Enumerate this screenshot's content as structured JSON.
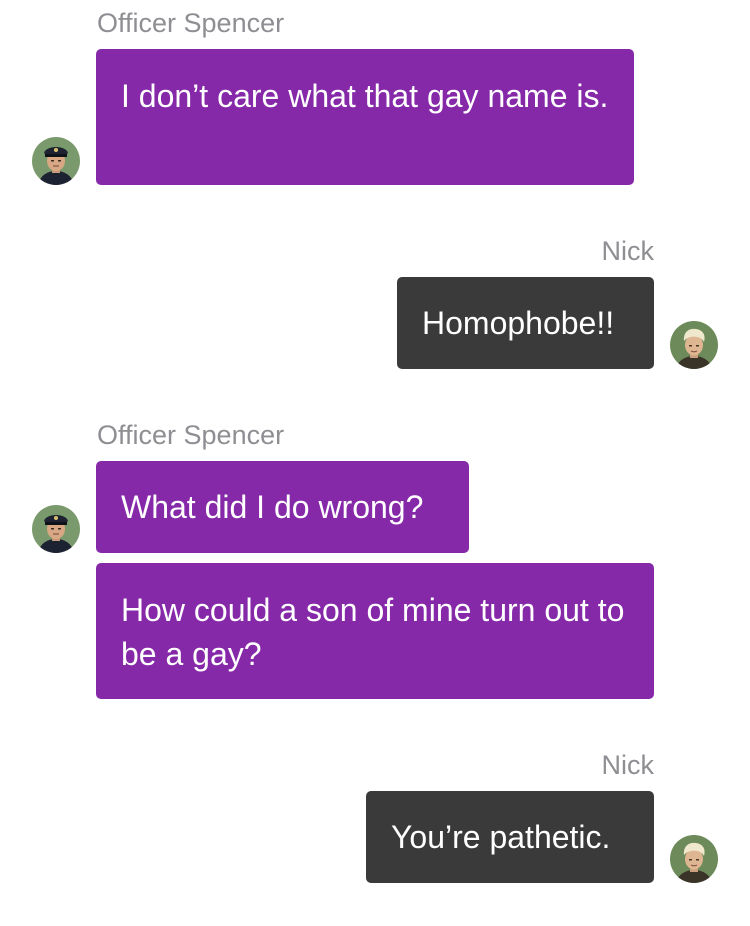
{
  "conversation": {
    "messages": [
      {
        "sender": "Officer Spencer",
        "text": "I don’t care what that gay name is."
      },
      {
        "sender": "Nick",
        "text": "Homophobe!!"
      },
      {
        "sender": "Officer Spencer",
        "text": "What did I do wrong?"
      },
      {
        "sender": "Officer Spencer",
        "text": "How could a son of mine turn out to be a gay?"
      },
      {
        "sender": "Nick",
        "text": "You’re pathetic."
      }
    ]
  },
  "colors": {
    "officer_bubble": "#8629a9",
    "nick_bubble": "#3a3a3a",
    "sender_label": "#8e8e93",
    "background": "#ffffff"
  },
  "avatars": {
    "officer": "police-officer-avatar-icon",
    "nick": "blond-man-avatar-icon"
  }
}
